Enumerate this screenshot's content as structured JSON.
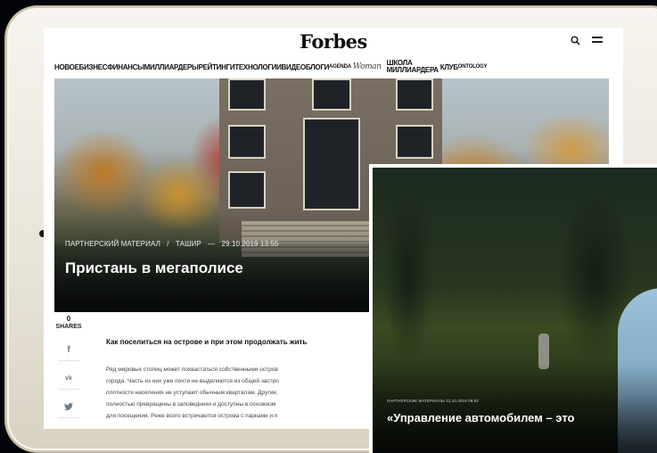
{
  "site": {
    "logo": "Forbes",
    "nav": [
      {
        "label": "НОВОЕ",
        "style": "normal"
      },
      {
        "label": "БИЗНЕС",
        "style": "normal"
      },
      {
        "label": "ФИНАНСЫ",
        "style": "normal"
      },
      {
        "label": "МИЛЛИАРДЕРЫ",
        "style": "normal"
      },
      {
        "label": "РЕЙТИНГИ",
        "style": "normal"
      },
      {
        "label": "ТЕХНОЛОГИИ",
        "style": "normal"
      },
      {
        "label": "ВИДЕО",
        "style": "normal"
      },
      {
        "label": "БЛОГИ",
        "style": "normal"
      },
      {
        "label": "AGENDA",
        "style": "small"
      },
      {
        "label": "Woman",
        "style": "serif"
      },
      {
        "label": "ШКОЛА",
        "style": "stack-top"
      },
      {
        "label": "МИЛЛИАРДЕРА",
        "style": "stack-bottom"
      },
      {
        "label": "КЛУБ",
        "style": "normal"
      },
      {
        "label": "ONTOLOGY",
        "style": "small"
      }
    ]
  },
  "hero": {
    "category": "ПАРТНЕРСКИЙ МАТЕРИАЛ",
    "separator": "/",
    "partner": "ТАШИР",
    "dash": "—",
    "date": "29.10.2019 13:55",
    "title": "Пристань в мегаполисе"
  },
  "shares": {
    "count": "0",
    "label": "SHARES",
    "buttons": [
      {
        "name": "facebook",
        "glyph": "f"
      },
      {
        "name": "vk",
        "glyph": "vk"
      },
      {
        "name": "twitter",
        "glyph": "🐦"
      }
    ]
  },
  "article": {
    "lead": "Как поселиться на острове и при этом продолжать жить",
    "lines": [
      "Ряд мировых столиц может похвастаться собственными остров",
      "города. Часть из них уже почти не выделяются из общей застро",
      "плотности населения не уступают обычным кварталам. Другие,",
      "полностью превращены в заповедники и доступны в основном",
      "для посещения. Реже всего встречаются острова с парками и п"
    ]
  },
  "video": {
    "meta": "ПАРТНЕРСКИЕ МАТЕРИАЛЫ 31.10.2019 08:52",
    "title": "«Управление автомобилем – это"
  },
  "colors": {
    "background": "#020409",
    "frame": "#e9e5da",
    "share_icon": "#6a7b8a"
  }
}
